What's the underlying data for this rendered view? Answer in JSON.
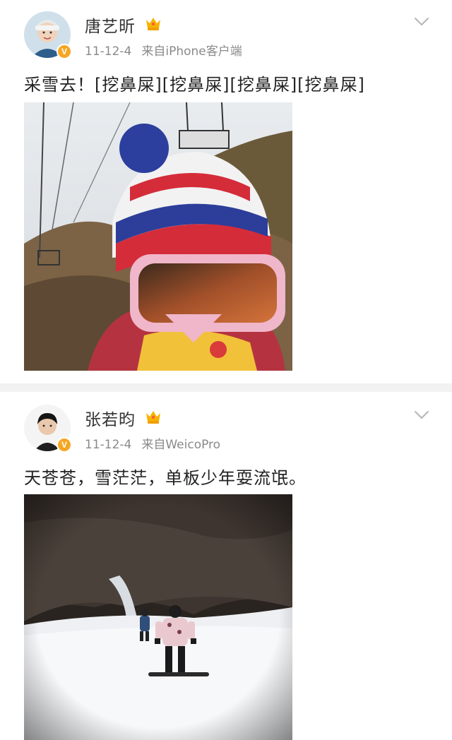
{
  "posts": [
    {
      "username": "唐艺昕",
      "date": "11-12-4",
      "source": "来自iPhone客户端",
      "text": "采雪去！[挖鼻屎][挖鼻屎][挖鼻屎][挖鼻屎]",
      "avatar_icon": "avatar-woman-with-cap",
      "badge_icon": "verified-v-icon",
      "crown_icon": "vip-crown-icon",
      "menu_icon": "chevron-down-icon",
      "photo_description_icon": "ski-selfie-photo"
    },
    {
      "username": "张若昀",
      "date": "11-12-4",
      "source": "来自WeicoPro",
      "text": "天苍苍，雪茫茫，单板少年耍流氓。",
      "avatar_icon": "avatar-man-portrait",
      "badge_icon": "verified-v-icon",
      "crown_icon": "vip-crown-icon",
      "menu_icon": "chevron-down-icon",
      "photo_description_icon": "snowboarding-photo"
    }
  ],
  "badge_text": "V",
  "colors": {
    "username": "#333333",
    "meta": "#8a8a8a",
    "body": "#222222",
    "verified": "#f6a623",
    "divider": "#f2f2f2"
  }
}
